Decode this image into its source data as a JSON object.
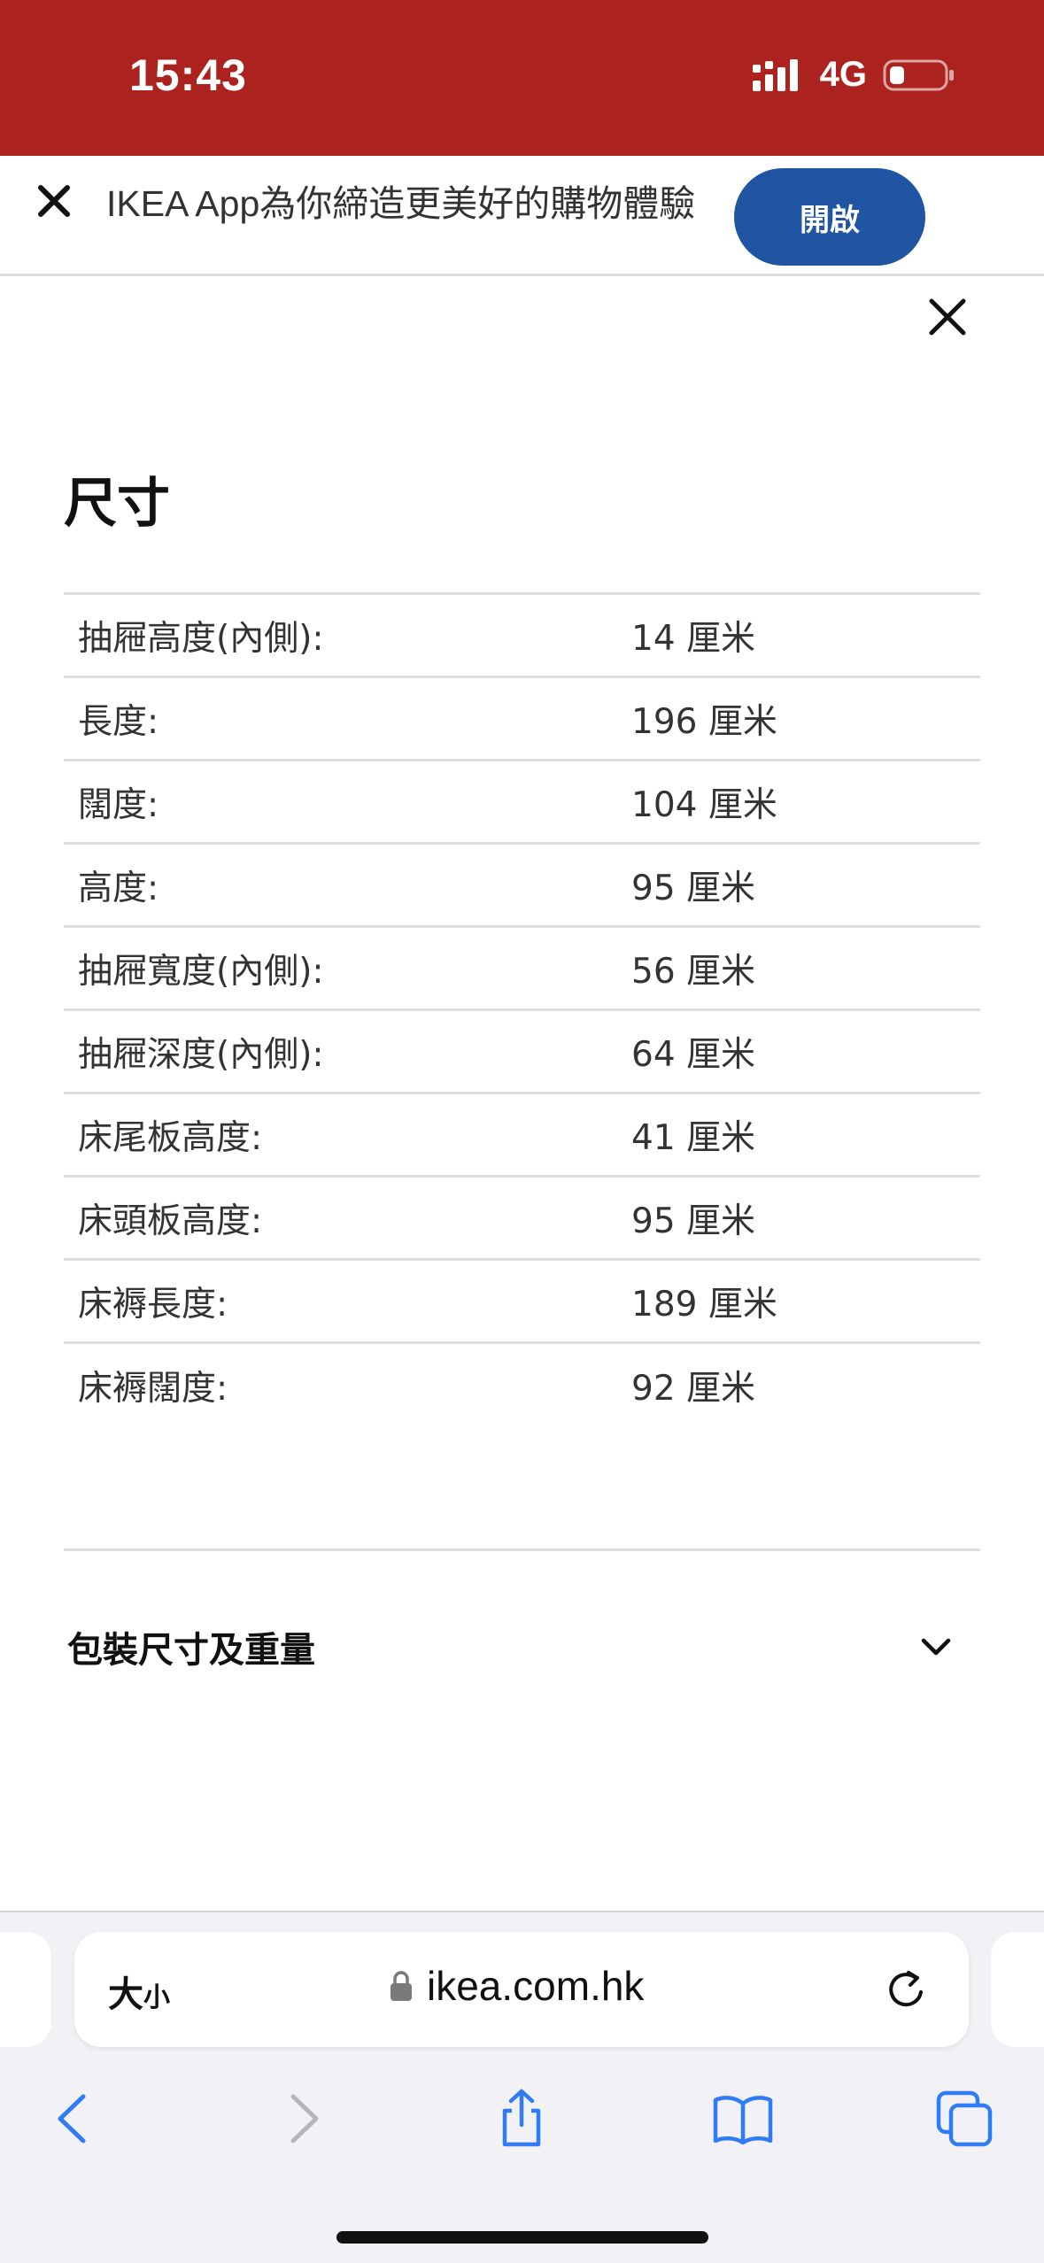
{
  "status_bar": {
    "time": "15:43",
    "network": "4G",
    "icons": [
      "signal-icon",
      "battery-icon"
    ]
  },
  "app_banner": {
    "text": "IKEA App為你締造更美好的購物體驗",
    "open_label": "開啟",
    "close_icon": "close-icon",
    "button_color": "#1f55a3"
  },
  "dimensions": {
    "title": "尺寸",
    "rows": [
      {
        "label": "抽屜高度(內側):",
        "value": "14 厘米"
      },
      {
        "label": "長度:",
        "value": "196 厘米"
      },
      {
        "label": "闊度:",
        "value": "104 厘米"
      },
      {
        "label": "高度:",
        "value": "95 厘米"
      },
      {
        "label": "抽屜寬度(內側):",
        "value": "56 厘米"
      },
      {
        "label": "抽屜深度(內側):",
        "value": "64 厘米"
      },
      {
        "label": "床尾板高度:",
        "value": "41 厘米"
      },
      {
        "label": "床頭板高度:",
        "value": "95 厘米"
      },
      {
        "label": "床褥長度:",
        "value": "189 厘米"
      },
      {
        "label": "床褥闊度:",
        "value": "92 厘米"
      }
    ]
  },
  "package_section": {
    "label": "包裝尺寸及重量",
    "icon": "chevron-down-icon"
  },
  "browser": {
    "text_size_big": "大",
    "text_size_small": "小",
    "url": "ikea.com.hk",
    "accent_color": "#2f7cf6",
    "icons": [
      "lock-icon",
      "reload-icon",
      "back-icon",
      "forward-icon",
      "share-icon",
      "bookmarks-icon",
      "tabs-icon"
    ]
  },
  "colors": {
    "status_bar_bg": "#ab221f"
  }
}
